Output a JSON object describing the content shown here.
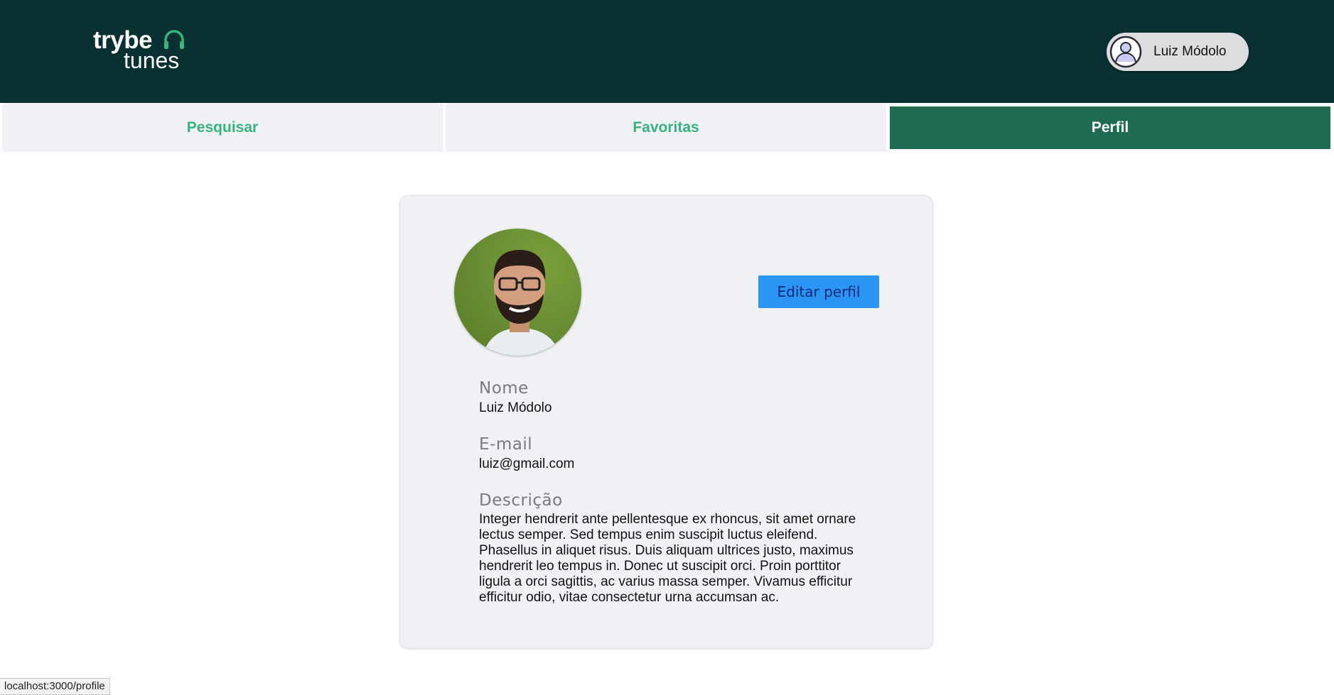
{
  "brand": {
    "line1": "trybe",
    "line2": "tunes",
    "icon": "headphones-icon",
    "accent": "#36b37e"
  },
  "user": {
    "name": "Luiz Módolo",
    "avatar_icon": "user-circle-icon"
  },
  "nav": {
    "tabs": [
      {
        "label": "Pesquisar",
        "active": false
      },
      {
        "label": "Favoritas",
        "active": false
      },
      {
        "label": "Perfil",
        "active": true
      }
    ]
  },
  "profile": {
    "edit_label": "Editar perfil",
    "name_label": "Nome",
    "name": "Luiz Módolo",
    "email_label": "E-mail",
    "email": "luiz@gmail.com",
    "description_label": "Descrição",
    "description": "Integer hendrerit ante pellentesque ex rhoncus, sit amet ornare lectus semper. Sed tempus enim suscipit luctus eleifend. Phasellus in aliquet risus. Duis aliquam ultrices justo, maximus hendrerit leo tempus in. Donec ut suscipit orci. Proin porttitor ligula a orci sagittis, ac varius massa semper. Vivamus efficitur efficitur odio, vitae consectetur urna accumsan ac."
  },
  "status_bar": {
    "url": "localhost:3000/profile"
  },
  "colors": {
    "header": "#093131",
    "active_tab": "#1e6b52",
    "button": "#2b95f5"
  }
}
